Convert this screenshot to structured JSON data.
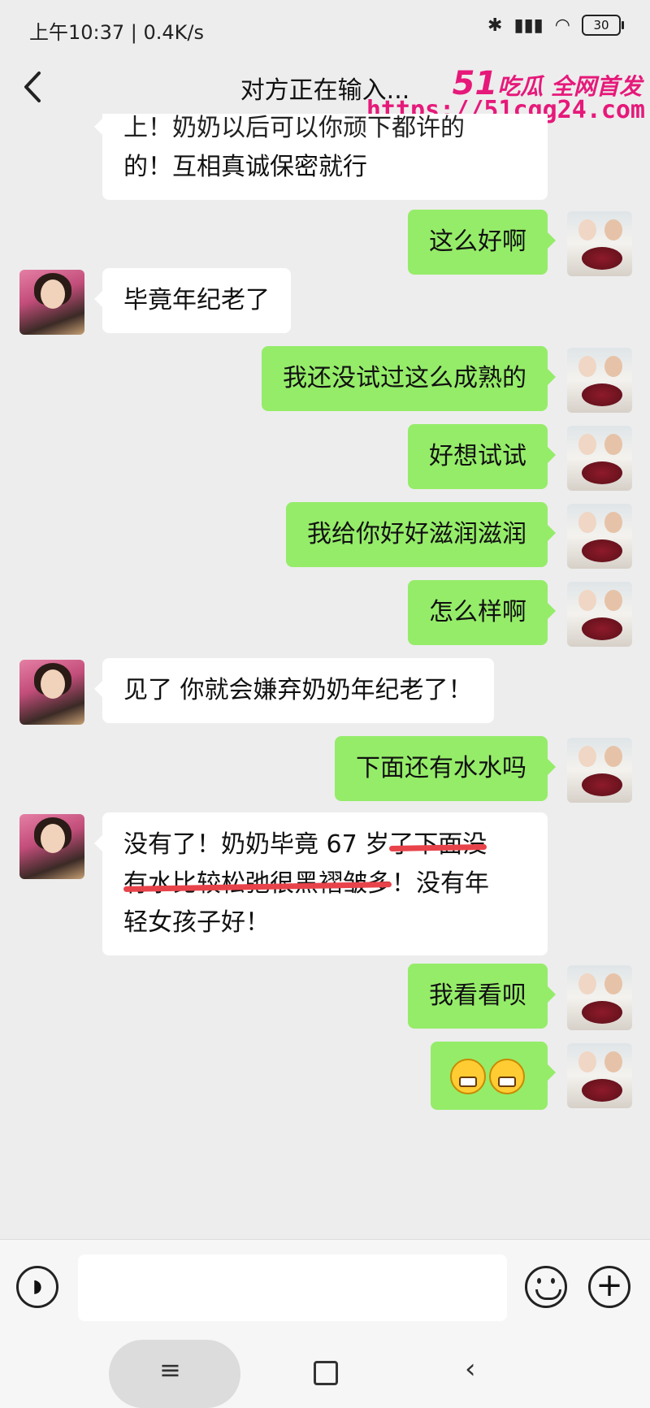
{
  "status": {
    "time": "上午10:37 | 0.4K/s",
    "battery": "30"
  },
  "header": {
    "title": "对方正在输入..."
  },
  "watermark": {
    "brand_num": "51",
    "brand_text": "吃瓜 全网首发",
    "url": "https://51cgg24.com"
  },
  "messages": [
    {
      "from": "them",
      "text_line1": "上！奶奶以后可以你顽下都许的",
      "text_line2": "的！互相真诚保密就行"
    },
    {
      "from": "me",
      "text": "这么好啊"
    },
    {
      "from": "them",
      "text": "毕竟年纪老了"
    },
    {
      "from": "me",
      "text": "我还没试过这么成熟的"
    },
    {
      "from": "me",
      "text": "好想试试"
    },
    {
      "from": "me",
      "text": "我给你好好滋润滋润"
    },
    {
      "from": "me",
      "text": "怎么样啊"
    },
    {
      "from": "them",
      "text": "见了 你就会嫌弃奶奶年纪老了！"
    },
    {
      "from": "me",
      "text": "下面还有水水吗"
    },
    {
      "from": "them",
      "line1_a": "没有了！奶奶毕竟 67 岁",
      "line1_struck": "了下面没",
      "line2_struck": "有水比较松弛很黑褶皱多",
      "line2_b": "！没有年",
      "line3": "轻女孩子好！"
    },
    {
      "from": "me",
      "text": "我看看呗"
    },
    {
      "from": "me",
      "emoji": "grin-emoji x2"
    }
  ],
  "input": {
    "placeholder": ""
  },
  "colors": {
    "out_bubble": "#95ec69",
    "in_bubble": "#ffffff",
    "background": "#ededed",
    "watermark": "#e6197a"
  }
}
